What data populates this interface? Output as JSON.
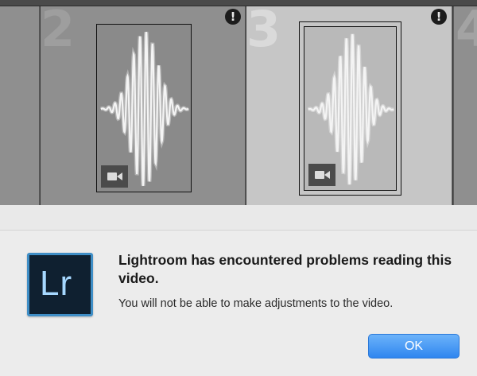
{
  "grid": {
    "cells": [
      {
        "index": ""
      },
      {
        "index": "2",
        "alert": "!",
        "media": "video"
      },
      {
        "index": "3",
        "alert": "!",
        "media": "video",
        "selected": true
      },
      {
        "index": "4"
      }
    ],
    "icons": {
      "alert": "exclamation-circle-icon",
      "video": "video-camera-icon",
      "thumbnail": "waveform-placeholder-icon"
    }
  },
  "dialog": {
    "app_icon_text": "Lr",
    "title": "Lightroom has encountered problems reading this video.",
    "message": "You will not be able to make adjustments to the video.",
    "ok_label": "OK",
    "colors": {
      "accent": "#3f8ec6",
      "app_icon_bg": "#0f2030",
      "app_icon_text": "#a6d8ff",
      "button": "#2f86ef"
    }
  }
}
